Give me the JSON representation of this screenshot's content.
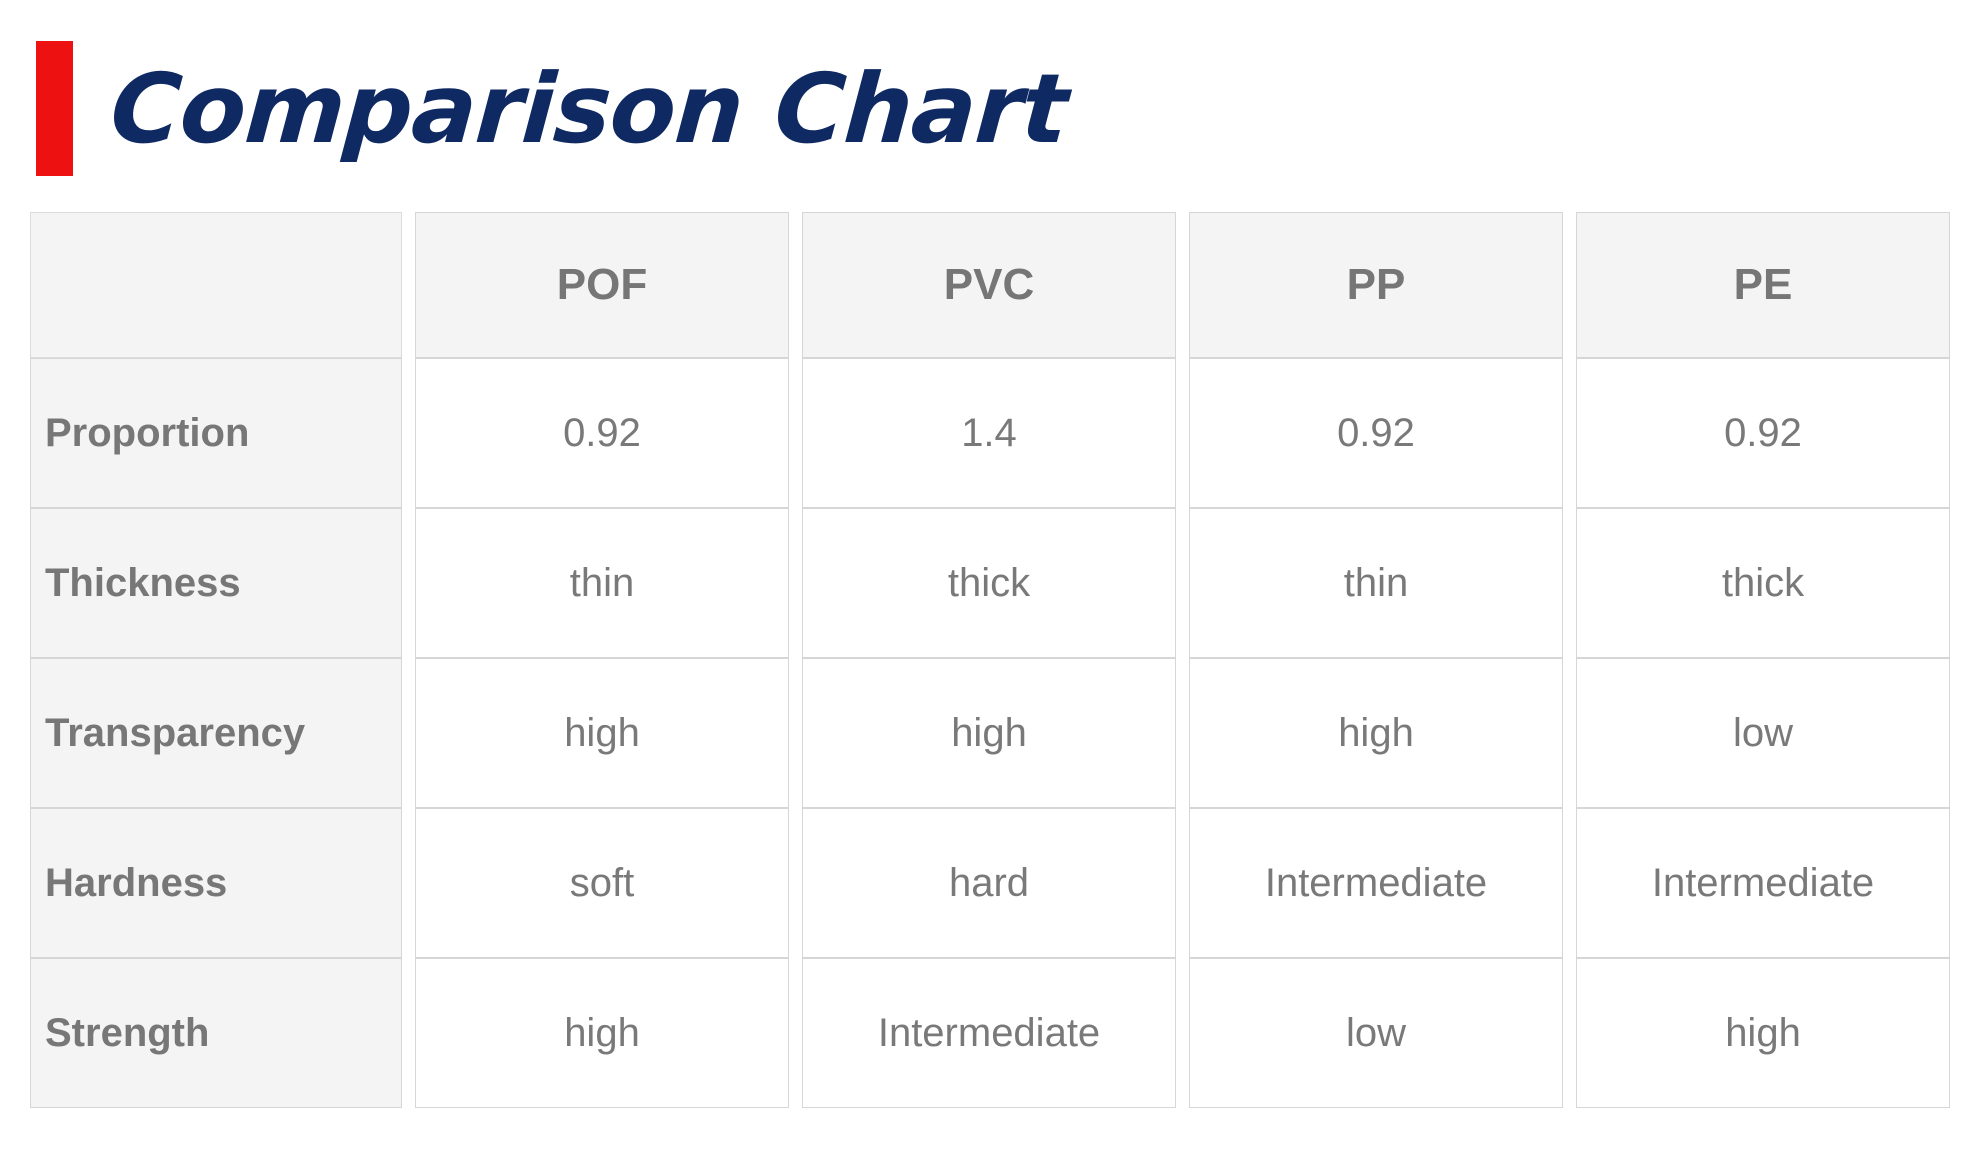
{
  "header": {
    "title": "Comparison Chart",
    "accent_bar_color": "#ee1111",
    "title_color": "#0f2a63"
  },
  "theme": {
    "header_cell_bg": "#f4f4f4",
    "label_cell_bg": "#f4f4f4",
    "data_cell_bg": "#ffffff",
    "border_color": "#d6d6d6",
    "text_gray": "#777777"
  },
  "table": {
    "corner_label": "",
    "columns": [
      "POF",
      "PVC",
      "PP",
      "PE"
    ],
    "row_labels": [
      "Proportion",
      "Thickness",
      "Transparency",
      "Hardness",
      "Strength"
    ],
    "rows": [
      {
        "label": "Proportion",
        "cells": [
          "0.92",
          "1.4",
          "0.92",
          "0.92"
        ]
      },
      {
        "label": "Thickness",
        "cells": [
          "thin",
          "thick",
          "thin",
          "thick"
        ]
      },
      {
        "label": "Transparency",
        "cells": [
          "high",
          "high",
          "high",
          "low"
        ]
      },
      {
        "label": "Hardness",
        "cells": [
          "soft",
          "hard",
          "Intermediate",
          "Intermediate"
        ]
      },
      {
        "label": "Strength",
        "cells": [
          "high",
          "Intermediate",
          "low",
          "high"
        ]
      }
    ]
  },
  "chart_data": {
    "type": "table",
    "title": "Comparison Chart",
    "categories": [
      "POF",
      "PVC",
      "PP",
      "PE"
    ],
    "row_labels": [
      "Proportion",
      "Thickness",
      "Transparency",
      "Hardness",
      "Strength"
    ],
    "series": [
      {
        "name": "Proportion",
        "values": [
          "0.92",
          "1.4",
          "0.92",
          "0.92"
        ]
      },
      {
        "name": "Thickness",
        "values": [
          "thin",
          "thick",
          "thin",
          "thick"
        ]
      },
      {
        "name": "Transparency",
        "values": [
          "high",
          "high",
          "high",
          "low"
        ]
      },
      {
        "name": "Hardness",
        "values": [
          "soft",
          "hard",
          "Intermediate",
          "Intermediate"
        ]
      },
      {
        "name": "Strength",
        "values": [
          "high",
          "Intermediate",
          "low",
          "high"
        ]
      }
    ],
    "xlabel": "",
    "ylabel": "",
    "grid": true,
    "legend": "none"
  }
}
